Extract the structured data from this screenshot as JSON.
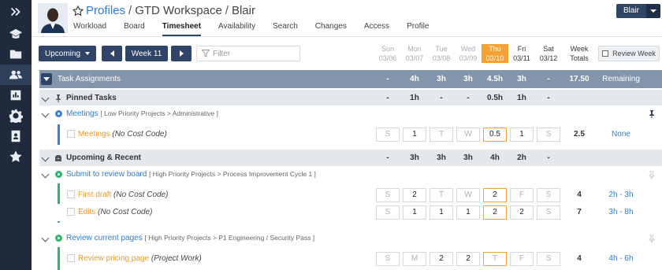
{
  "sidebar": {
    "icons": [
      "expand-icon",
      "graduation-cap-icon",
      "folder-icon",
      "users-icon",
      "chart-icon",
      "gear-icon",
      "contact-card-icon",
      "star-icon"
    ]
  },
  "header": {
    "profiles_link": "Profiles",
    "workspace": "GTD Workspace",
    "user": "Blair"
  },
  "user_button": {
    "label": "Blair"
  },
  "nav_tabs": [
    "Workload",
    "Board",
    "Timesheet",
    "Availability",
    "Search",
    "Changes",
    "Access",
    "Profile"
  ],
  "toolbar": {
    "filter_select": "Upcoming",
    "week_label": "Week 11",
    "filter_placeholder": "Filter",
    "review_label": "Review Week"
  },
  "days": [
    {
      "name": "Sun",
      "date": "03/06"
    },
    {
      "name": "Mon",
      "date": "03/07"
    },
    {
      "name": "Tue",
      "date": "03/08"
    },
    {
      "name": "Wed",
      "date": "03/09"
    },
    {
      "name": "Thu",
      "date": "03/10"
    },
    {
      "name": "Fri",
      "date": "03/11"
    },
    {
      "name": "Sat",
      "date": "03/12"
    }
  ],
  "week_totals_label": [
    "Week",
    "Totals"
  ],
  "task_header": {
    "label": "Task Assignments",
    "values": [
      "-",
      "4h",
      "3h",
      "3h",
      "4.5h",
      "3h",
      "-"
    ],
    "total": "17.50",
    "remaining": "Remaining"
  },
  "pinned": {
    "label": "Pinned Tasks",
    "values": [
      "-",
      "1h",
      "-",
      "-",
      "0.5h",
      "1h",
      "-"
    ]
  },
  "meetings_project": {
    "name": "Meetings",
    "path": "[ Low Priority Projects > Administrative ]"
  },
  "meetings_item": {
    "name": "Meetings",
    "cost": "(No Cost Code)",
    "days": [
      "S",
      "1",
      "T",
      "W",
      "0.5",
      "1",
      "S"
    ],
    "total": "2.5",
    "remaining": "None"
  },
  "upcoming": {
    "label": "Upcoming & Recent",
    "values": [
      "-",
      "3h",
      "3h",
      "3h",
      "4h",
      "2h",
      "-"
    ]
  },
  "submit_project": {
    "name": "Submit to review board",
    "path": "[ High Priority Projects > Process Improvement Cycle 1 ]"
  },
  "first_draft": {
    "name": "First draft",
    "cost": "(No Cost Code)",
    "days": [
      "S",
      "2",
      "T",
      "W",
      "2",
      "F",
      "S"
    ],
    "total": "4",
    "remaining": "2h - 3h"
  },
  "edits": {
    "name": "Edits",
    "cost": "(No Cost Code)",
    "days": [
      "S",
      "1",
      "1",
      "1",
      "2",
      "2",
      "S"
    ],
    "total": "7",
    "remaining": "3h - 8h"
  },
  "review_project": {
    "name": "Review current pages",
    "path": "[ High Priority Projects > P1 Engineering / Security Pass ]"
  },
  "review_item": {
    "name": "Review pricing page",
    "cost": "(Project Work)",
    "days": [
      "S",
      "M",
      "2",
      "2",
      "T",
      "F",
      "S"
    ],
    "total": "4",
    "remaining": "4h - 6h"
  },
  "colors": {
    "navy": "#2f4466",
    "accent_orange": "#f5a134",
    "link_blue": "#2f7bd6",
    "green": "#34b36a",
    "blue_bar": "#3b82d6"
  }
}
